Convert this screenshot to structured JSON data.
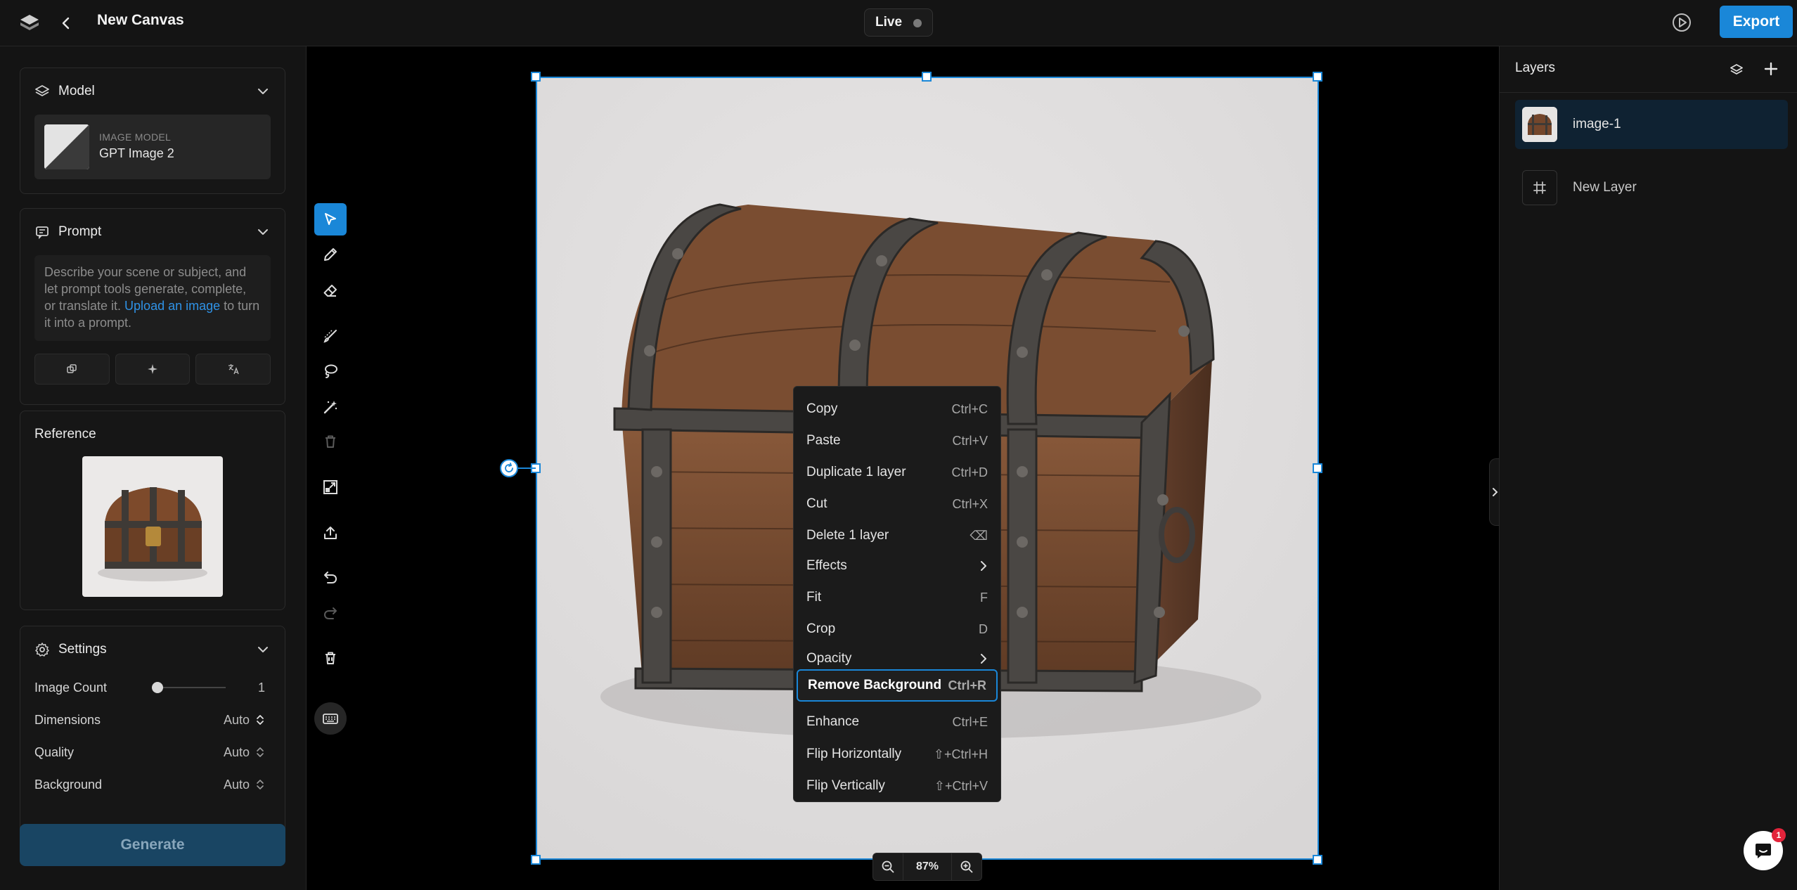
{
  "header": {
    "title": "New Canvas",
    "live_label": "Live",
    "export_label": "Export"
  },
  "model": {
    "heading": "Model",
    "caption": "IMAGE MODEL",
    "name": "GPT Image 2"
  },
  "prompt": {
    "heading": "Prompt",
    "placeholder_start": "Describe your scene or subject, and let prompt tools generate, complete, or translate it. ",
    "link_text": "Upload an image",
    "placeholder_end": " to turn it into a prompt."
  },
  "reference": {
    "heading": "Reference"
  },
  "settings": {
    "heading": "Settings",
    "image_count_label": "Image Count",
    "image_count_value": "1",
    "dimensions_label": "Dimensions",
    "dimensions_value": "Auto",
    "quality_label": "Quality",
    "quality_value": "Auto",
    "background_label": "Background",
    "background_value": "Auto"
  },
  "generate_label": "Generate",
  "context_menu": {
    "items": [
      {
        "label": "Copy",
        "shortcut": "Ctrl+C"
      },
      {
        "label": "Paste",
        "shortcut": "Ctrl+V"
      },
      {
        "label": "Duplicate 1 layer",
        "shortcut": "Ctrl+D"
      },
      {
        "label": "Cut",
        "shortcut": "Ctrl+X"
      },
      {
        "label": "Delete 1 layer",
        "shortcut": "⌫"
      },
      {
        "label": "Effects",
        "shortcut": ""
      },
      {
        "label": "Fit",
        "shortcut": "F"
      },
      {
        "label": "Crop",
        "shortcut": "D"
      },
      {
        "label": "Opacity",
        "shortcut": ""
      },
      {
        "label": "Remove Background",
        "shortcut": "Ctrl+R"
      },
      {
        "label": "Enhance",
        "shortcut": "Ctrl+E"
      },
      {
        "label": "Flip Horizontally",
        "shortcut": "⇧+Ctrl+H"
      },
      {
        "label": "Flip Vertically",
        "shortcut": "⇧+Ctrl+V"
      }
    ]
  },
  "zoom": {
    "value": "87%"
  },
  "layers": {
    "heading": "Layers",
    "items": [
      {
        "name": "image-1"
      },
      {
        "name": "New Layer"
      }
    ]
  },
  "chat": {
    "badge": "1"
  },
  "colors": {
    "accent": "#1a87d8",
    "generate_disabled": "#194563",
    "panel": "#141414",
    "badge": "#e3243b"
  }
}
